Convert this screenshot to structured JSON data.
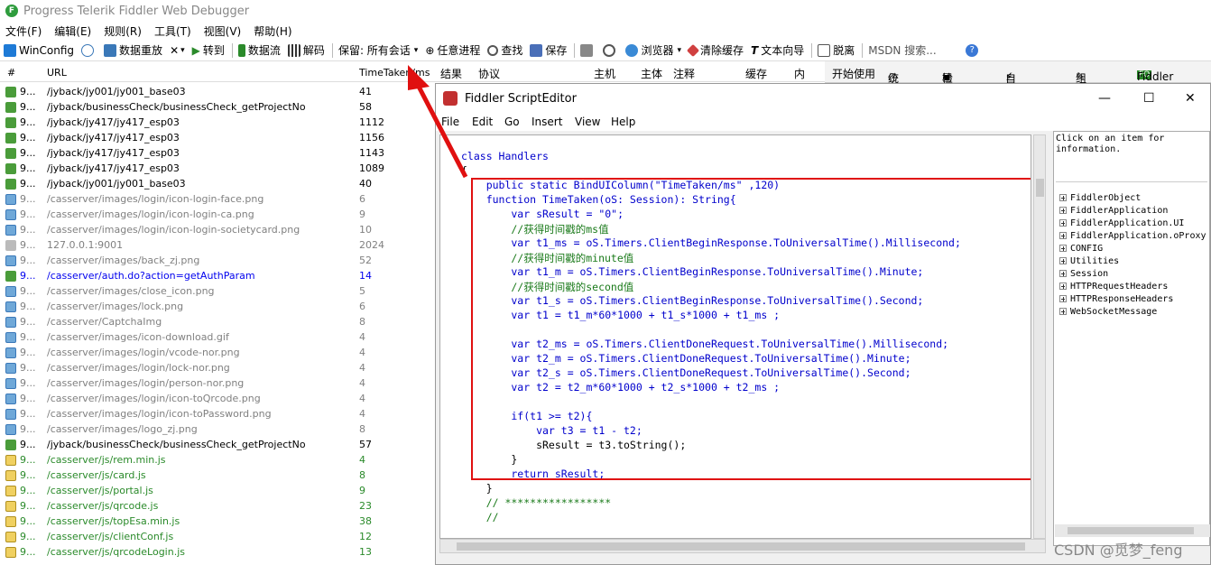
{
  "window": {
    "title": "Progress Telerik Fiddler Web Debugger",
    "logo_text": "F"
  },
  "menu": [
    "文件(F)",
    "编辑(E)",
    "规则(R)",
    "工具(T)",
    "视图(V)",
    "帮助(H)"
  ],
  "toolbar": {
    "winconfig": "WinConfig",
    "replay": "数据重放",
    "remove": "✕",
    "go": "转到",
    "stream": "数据流",
    "decode": "解码",
    "keep": "保留: 所有会话",
    "process": "任意进程",
    "find": "查找",
    "save": "保存",
    "browser": "浏览器",
    "clear_cache": "清除缓存",
    "text_wizard": "文本向导",
    "detach": "脱离",
    "msdn": "MSDN 搜索..."
  },
  "list_header": {
    "num": "#",
    "url": "URL",
    "time": "TimeTaken/ms"
  },
  "right_header": {
    "result": "结果",
    "protocol": "协议",
    "host": "主机",
    "body": "主体",
    "comment": "注释",
    "cache": "缓存",
    "content": "内"
  },
  "tabs": {
    "getting_started": "开始使用",
    "stats": "统计",
    "inspectors": "检查器",
    "autoresponder": "自动响应",
    "composer": "组合器",
    "orch": "Fiddler Orch"
  },
  "sessions": [
    {
      "num": "9...",
      "url": "/jyback/jy001/jy001_base03",
      "time": "41",
      "type": "arrow",
      "color": "#000000"
    },
    {
      "num": "9...",
      "url": "/jyback/businessCheck/businessCheck_getProjectNo",
      "time": "58",
      "type": "arrow",
      "color": "#000000"
    },
    {
      "num": "9...",
      "url": "/jyback/jy417/jy417_esp03",
      "time": "1112",
      "type": "arrow",
      "color": "#000000"
    },
    {
      "num": "9...",
      "url": "/jyback/jy417/jy417_esp03",
      "time": "1156",
      "type": "arrow",
      "color": "#000000"
    },
    {
      "num": "9...",
      "url": "/jyback/jy417/jy417_esp03",
      "time": "1143",
      "type": "arrow",
      "color": "#000000"
    },
    {
      "num": "9...",
      "url": "/jyback/jy417/jy417_esp03",
      "time": "1089",
      "type": "arrow",
      "color": "#000000"
    },
    {
      "num": "9...",
      "url": "/jyback/jy001/jy001_base03",
      "time": "40",
      "type": "arrow",
      "color": "#000000"
    },
    {
      "num": "9...",
      "url": "/casserver/images/login/icon-login-face.png",
      "time": "6",
      "type": "img",
      "color": "#808080"
    },
    {
      "num": "9...",
      "url": "/casserver/images/login/icon-login-ca.png",
      "time": "9",
      "type": "img",
      "color": "#808080"
    },
    {
      "num": "9...",
      "url": "/casserver/images/login/icon-login-societycard.png",
      "time": "10",
      "type": "img",
      "color": "#808080"
    },
    {
      "num": "9...",
      "url": "127.0.0.1:9001",
      "time": "2024",
      "type": "lock",
      "color": "#808080"
    },
    {
      "num": "9...",
      "url": "/casserver/images/back_zj.png",
      "time": "52",
      "type": "img",
      "color": "#808080"
    },
    {
      "num": "9...",
      "url": "/casserver/auth.do?action=getAuthParam",
      "time": "14",
      "type": "arrow",
      "color": "#0000ee"
    },
    {
      "num": "9...",
      "url": "/casserver/images/close_icon.png",
      "time": "5",
      "type": "img",
      "color": "#808080"
    },
    {
      "num": "9...",
      "url": "/casserver/images/lock.png",
      "time": "6",
      "type": "img",
      "color": "#808080"
    },
    {
      "num": "9...",
      "url": "/casserver/CaptchaImg",
      "time": "8",
      "type": "img",
      "color": "#808080"
    },
    {
      "num": "9...",
      "url": "/casserver/images/icon-download.gif",
      "time": "4",
      "type": "img",
      "color": "#808080"
    },
    {
      "num": "9...",
      "url": "/casserver/images/login/vcode-nor.png",
      "time": "4",
      "type": "img",
      "color": "#808080"
    },
    {
      "num": "9...",
      "url": "/casserver/images/login/lock-nor.png",
      "time": "4",
      "type": "img",
      "color": "#808080"
    },
    {
      "num": "9...",
      "url": "/casserver/images/login/person-nor.png",
      "time": "4",
      "type": "img",
      "color": "#808080"
    },
    {
      "num": "9...",
      "url": "/casserver/images/login/icon-toQrcode.png",
      "time": "4",
      "type": "img",
      "color": "#808080"
    },
    {
      "num": "9...",
      "url": "/casserver/images/login/icon-toPassword.png",
      "time": "4",
      "type": "img",
      "color": "#808080"
    },
    {
      "num": "9...",
      "url": "/casserver/images/logo_zj.png",
      "time": "8",
      "type": "img",
      "color": "#808080"
    },
    {
      "num": "9...",
      "url": "/jyback/businessCheck/businessCheck_getProjectNo",
      "time": "57",
      "type": "arrow",
      "color": "#000000"
    },
    {
      "num": "9...",
      "url": "/casserver/js/rem.min.js",
      "time": "4",
      "type": "js",
      "color": "#2a8a2a"
    },
    {
      "num": "9...",
      "url": "/casserver/js/card.js",
      "time": "8",
      "type": "js",
      "color": "#2a8a2a"
    },
    {
      "num": "9...",
      "url": "/casserver/js/portal.js",
      "time": "9",
      "type": "js",
      "color": "#2a8a2a"
    },
    {
      "num": "9...",
      "url": "/casserver/js/qrcode.js",
      "time": "23",
      "type": "js",
      "color": "#2a8a2a"
    },
    {
      "num": "9...",
      "url": "/casserver/js/topEsa.min.js",
      "time": "38",
      "type": "js",
      "color": "#2a8a2a"
    },
    {
      "num": "9...",
      "url": "/casserver/js/clientConf.js",
      "time": "12",
      "type": "js",
      "color": "#2a8a2a"
    },
    {
      "num": "9...",
      "url": "/casserver/js/qrcodeLogin.js",
      "time": "13",
      "type": "js",
      "color": "#2a8a2a"
    }
  ],
  "dialog": {
    "title": "Fiddler ScriptEditor",
    "menu": [
      "File",
      "Edit",
      "Go",
      "Insert",
      "View",
      "Help"
    ],
    "side_info": "Click on an item for information.",
    "tree": [
      "FiddlerObject",
      "FiddlerApplication",
      "FiddlerApplication.UI",
      "FiddlerApplication.oProxy",
      "CONFIG",
      "Utilities",
      "Session",
      "HTTPRequestHeaders",
      "HTTPResponseHeaders",
      "WebSocketMessage"
    ]
  },
  "code": {
    "l01": "class Handlers",
    "l02": "{",
    "l03": "    public static BindUIColumn(\"TimeTaken/ms\" ,120)",
    "l04": "    function TimeTaken(oS: Session): String{",
    "l05": "        var sResult = \"0\";",
    "l06": "        //获得时间戳的ms值",
    "l07": "        var t1_ms = oS.Timers.ClientBeginResponse.ToUniversalTime().Millisecond;",
    "l08": "        //获得时间戳的minute值",
    "l09": "        var t1_m = oS.Timers.ClientBeginResponse.ToUniversalTime().Minute;",
    "l10": "        //获得时间戳的second值",
    "l11": "        var t1_s = oS.Timers.ClientBeginResponse.ToUniversalTime().Second;",
    "l12": "        var t1 = t1_m*60*1000 + t1_s*1000 + t1_ms ;",
    "l13": "        var t2_ms = oS.Timers.ClientDoneRequest.ToUniversalTime().Millisecond;",
    "l14": "        var t2_m = oS.Timers.ClientDoneRequest.ToUniversalTime().Minute;",
    "l15": "        var t2_s = oS.Timers.ClientDoneRequest.ToUniversalTime().Second;",
    "l16": "        var t2 = t2_m*60*1000 + t2_s*1000 + t2_ms ;",
    "l17": "        if(t1 >= t2){",
    "l18": "            var t3 = t1 - t2;",
    "l19": "            sResult = t3.toString();",
    "l20": "        }",
    "l21": "        return sResult;",
    "l22": "    }",
    "l23": "    // *****************",
    "l24": "    //"
  },
  "watermark": "CSDN @觅梦_feng",
  "colors": {
    "highlight_box": "#e01010",
    "keyword": "#0000cc",
    "comment": "#1a7a1a",
    "string": "#a31515"
  }
}
